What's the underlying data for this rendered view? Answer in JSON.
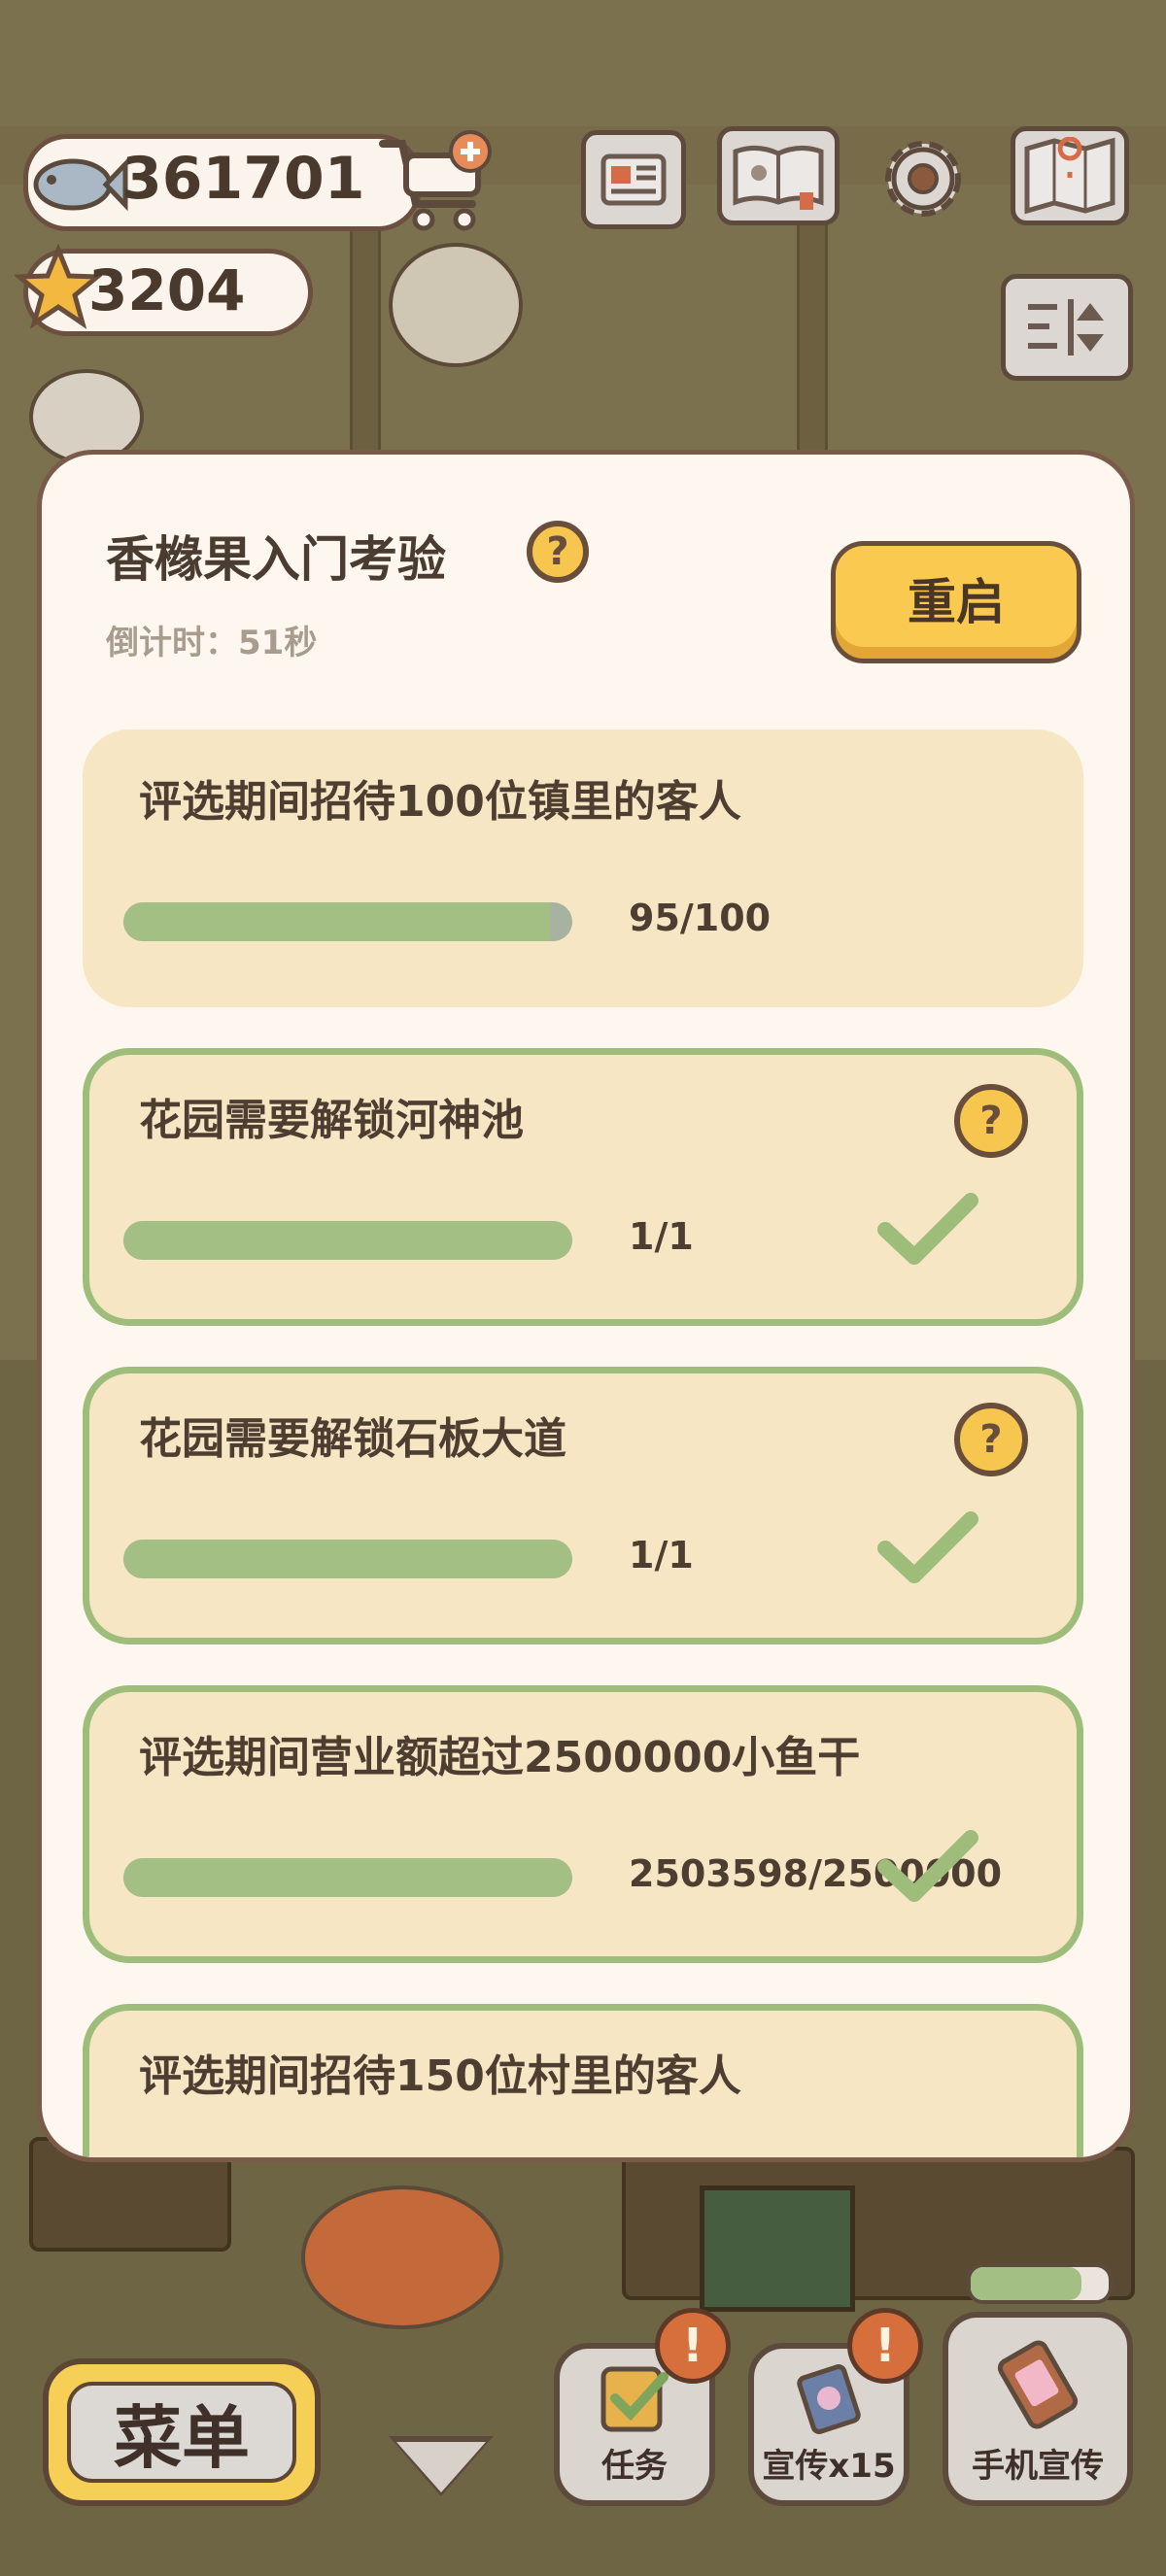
{
  "hud": {
    "fish_count": "361701",
    "star_count": "3204",
    "icons": [
      "fish-icon",
      "shop-cart-icon",
      "newspaper-icon",
      "recipe-book-icon",
      "gear-icon",
      "map-icon",
      "sort-icon",
      "star-icon"
    ]
  },
  "modal": {
    "title": "香橼果入门考验",
    "countdown": "倒计时：51秒",
    "restart_label": "重启",
    "help_glyph": "?"
  },
  "tasks": [
    {
      "label": "评选期间招待100位镇里的客人",
      "progress_text": "95/100",
      "progress": 0.95,
      "done": false,
      "has_help": false
    },
    {
      "label": "花园需要解锁河神池",
      "progress_text": "1/1",
      "progress": 1.0,
      "done": true,
      "has_help": true
    },
    {
      "label": "花园需要解锁石板大道",
      "progress_text": "1/1",
      "progress": 1.0,
      "done": true,
      "has_help": true
    },
    {
      "label": "评选期间营业额超过2500000小鱼干",
      "progress_text": "2503598/2500000",
      "progress": 1.0,
      "done": true,
      "has_help": false
    },
    {
      "label": "评选期间招待150位村里的客人",
      "progress_text": "",
      "progress": 0,
      "done": true,
      "has_help": false
    }
  ],
  "bottom": {
    "menu_label": "菜单",
    "task_label": "任务",
    "promo_label": "宣传x15",
    "phone_promo_label": "手机宣传",
    "alert_glyph": "!"
  },
  "colors": {
    "accent_yellow": "#f9ca4f",
    "done_green": "#9fbd7a",
    "bar_green": "#a4bf84",
    "card_bg": "#f6e6c4",
    "modal_bg": "#fdf7ef"
  }
}
